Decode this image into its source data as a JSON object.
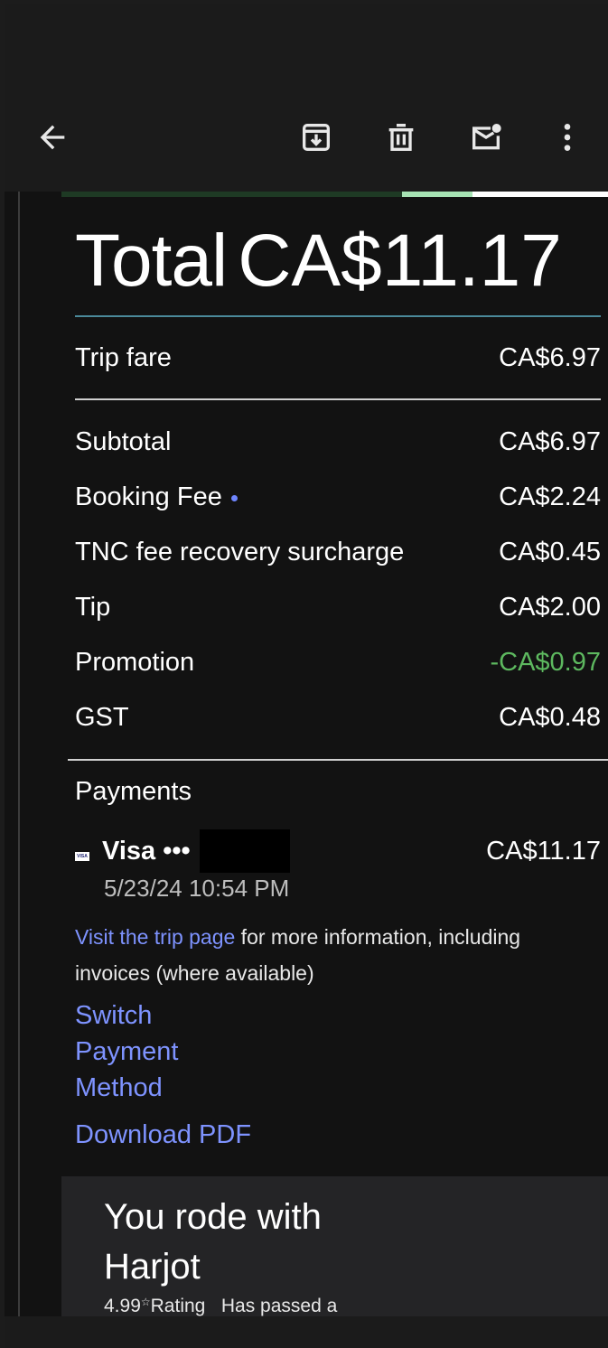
{
  "toolbar": {
    "icons": [
      "back-arrow-icon",
      "archive-icon",
      "trash-icon",
      "mark-unread-icon",
      "more-vertical-icon"
    ]
  },
  "receipt": {
    "total_label": "Total",
    "total_value": "CA$11.17",
    "trip_fare_label": "Trip fare",
    "trip_fare_value": "CA$6.97",
    "lines": [
      {
        "label": "Subtotal",
        "value": "CA$6.97"
      },
      {
        "label": "Booking Fee",
        "value": "CA$2.24"
      },
      {
        "label": "TNC fee recovery surcharge",
        "value": "CA$0.45"
      },
      {
        "label": "Tip",
        "value": "CA$2.00"
      },
      {
        "label": "Promotion",
        "value": "-CA$0.97"
      },
      {
        "label": "GST",
        "value": "CA$0.48"
      }
    ],
    "colors": {
      "promotion": "#5db85f",
      "link": "#7e93ff"
    }
  },
  "payments": {
    "title": "Payments",
    "card_brand": "Visa",
    "card_dots": "•••",
    "amount": "CA$11.17",
    "date": "5/23/24 10:54 PM",
    "visa_icon_text": "VISA"
  },
  "info": {
    "link_text": "Visit the trip page",
    "rest_text": " for more information, including invoices (where available)"
  },
  "links": {
    "switch_payment": "Switch Payment Method",
    "download_pdf": "Download PDF"
  },
  "rider": {
    "title": "You rode with Harjot",
    "meta": "4.99",
    "rating_label": "Rating",
    "passed": "Has passed a"
  }
}
